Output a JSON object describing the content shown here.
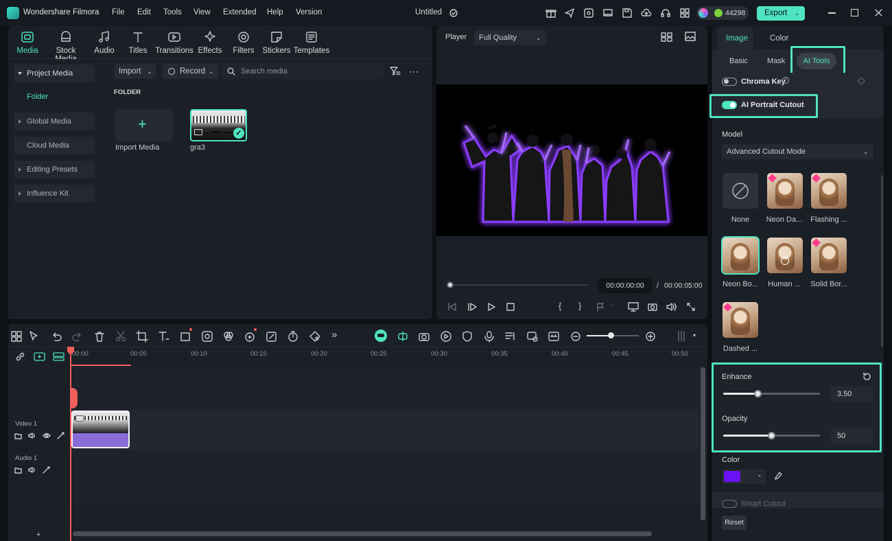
{
  "app": {
    "name": "Wondershare Filmora",
    "project_title": "Untitled",
    "credits": "44298",
    "export_label": "Export"
  },
  "menu": [
    "File",
    "Edit",
    "Tools",
    "View",
    "Extended",
    "Help",
    "Version"
  ],
  "media_tabs": [
    "Media",
    "Stock Media",
    "Audio",
    "Titles",
    "Transitions",
    "Effects",
    "Filters",
    "Stickers",
    "Templates"
  ],
  "sidebar": [
    "Project Media",
    "Folder",
    "Global Media",
    "Cloud Media",
    "Editing Presets",
    "Influence Kit"
  ],
  "media_toolbar": {
    "import": "Import",
    "record": "Record",
    "search_placeholder": "Search media"
  },
  "folder_label": "FOLDER",
  "media_items": [
    {
      "label": "Import Media"
    },
    {
      "label": "gra3"
    }
  ],
  "player": {
    "label": "Player",
    "quality": "Full Quality",
    "current_time": "00:00:00:00",
    "separator": "/",
    "total_time": "00:00:05:00"
  },
  "timeline": {
    "ticks": [
      "00:00",
      "00:05",
      "00:10",
      "00:15",
      "00:20",
      "00:25",
      "00:30",
      "00:35",
      "00:40",
      "00:45",
      "00:50"
    ],
    "tracks": [
      {
        "label": "Video 1"
      },
      {
        "label": "Audio 1"
      }
    ]
  },
  "right_panel": {
    "top_tabs": [
      "Image",
      "Color"
    ],
    "sub_tabs": [
      "Basic",
      "Mask",
      "AI Tools"
    ],
    "chroma_key": "Chroma Key",
    "ai_portrait": "AI Portrait Cutout",
    "model_label": "Model",
    "model_value": "Advanced Cutout Mode",
    "presets": [
      "None",
      "Neon Da...",
      "Flashing ...",
      "Neon Bo...",
      "Human ...",
      "Solid Bor...",
      "Dashed ..."
    ],
    "enhance": {
      "label": "Enhance",
      "value": "3.50",
      "fraction": 0.36
    },
    "opacity": {
      "label": "Opacity",
      "value": "50",
      "fraction": 0.5
    },
    "color_label": "Color",
    "color_value": "#6a12f5",
    "smart_cutout": "Smart Cutout",
    "reset": "Reset"
  },
  "colors": {
    "accent": "#4ee3c1",
    "playhead": "#f0605a",
    "glow": "#7b2dff"
  }
}
